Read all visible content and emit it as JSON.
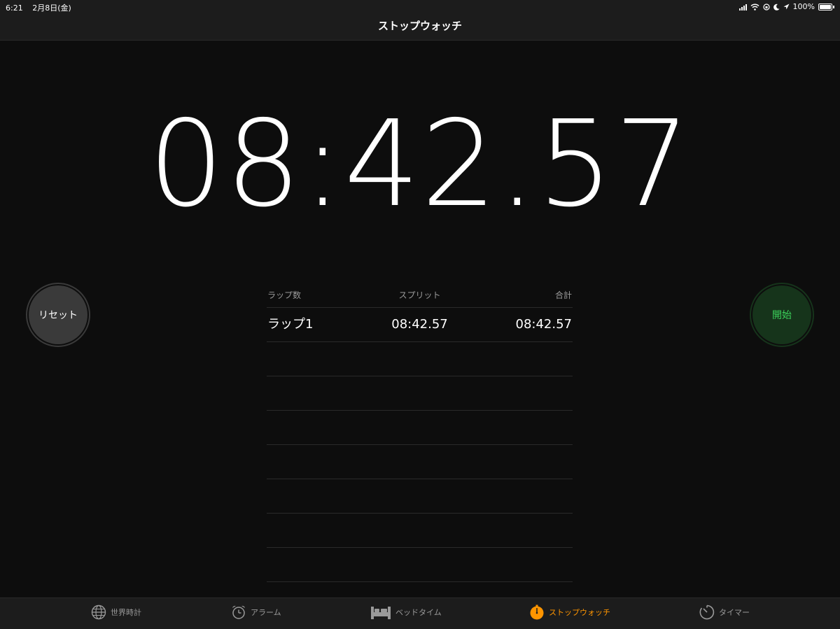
{
  "status_bar": {
    "time": "6:21",
    "date": "2月8日(金)",
    "battery": "100%"
  },
  "nav": {
    "title": "ストップウォッチ"
  },
  "stopwatch": {
    "time": "08:42.57"
  },
  "buttons": {
    "reset": "リセット",
    "start": "開始"
  },
  "laps": {
    "headers": {
      "lap": "ラップ数",
      "split": "スプリット",
      "total": "合計"
    },
    "rows": [
      {
        "lap": "ラップ1",
        "split": "08:42.57",
        "total": "08:42.57"
      }
    ]
  },
  "tabs": [
    {
      "label": "世界時計",
      "icon": "globe-icon"
    },
    {
      "label": "アラーム",
      "icon": "alarm-clock-icon"
    },
    {
      "label": "ベッドタイム",
      "icon": "bed-icon"
    },
    {
      "label": "ストップウォッチ",
      "icon": "stopwatch-icon",
      "active": true
    },
    {
      "label": "タイマー",
      "icon": "timer-icon"
    }
  ],
  "colors": {
    "accent": "#ff9500",
    "start_text": "#3bd15a",
    "start_bg": "#16341b",
    "reset_bg": "#3a3a3a"
  }
}
